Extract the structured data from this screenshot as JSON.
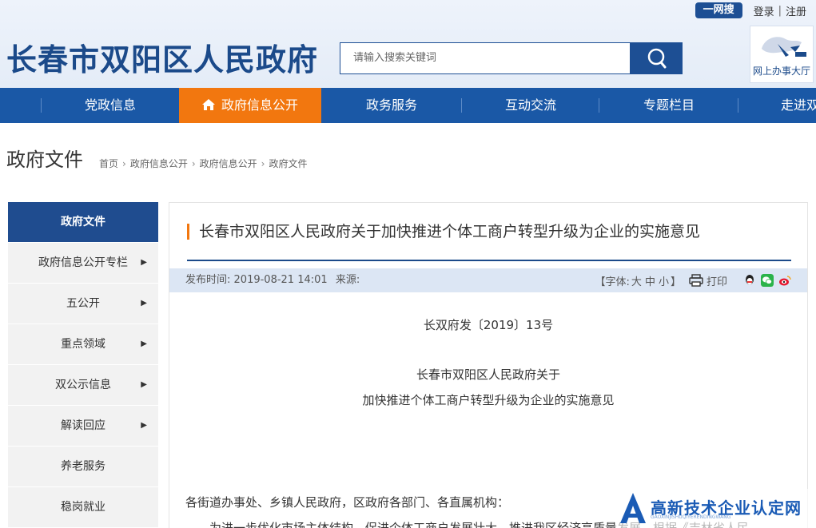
{
  "header": {
    "site_title": "长春市双阳区人民政府",
    "search_scope": "一网搜",
    "login": "登录",
    "register": "注册",
    "separator": "|",
    "search_placeholder": "请输入搜索关键词",
    "portal_label": "网上办事大厅"
  },
  "nav": {
    "items": [
      {
        "label": "党政信息"
      },
      {
        "label": "政府信息公开",
        "active": true
      },
      {
        "label": "政务服务"
      },
      {
        "label": "互动交流"
      },
      {
        "label": "专题栏目"
      },
      {
        "label": "走进双阳"
      }
    ]
  },
  "page": {
    "heading": "政府文件",
    "breadcrumb": [
      "首页",
      "政府信息公开",
      "政府信息公开",
      "政府文件"
    ],
    "breadcrumb_sep": "›"
  },
  "sidebar": {
    "items": [
      {
        "label": "政府文件",
        "active": true
      },
      {
        "label": "政府信息公开专栏",
        "arrow": "▶"
      },
      {
        "label": "五公开",
        "arrow": "▶"
      },
      {
        "label": "重点领域",
        "arrow": "▶"
      },
      {
        "label": "双公示信息",
        "arrow": "▶"
      },
      {
        "label": "解读回应",
        "arrow": "▶"
      },
      {
        "label": "养老服务"
      },
      {
        "label": "稳岗就业"
      }
    ]
  },
  "article": {
    "title": "长春市双阳区人民政府关于加快推进个体工商户转型升级为企业的实施意见",
    "publish_label": "发布时间:",
    "publish_time": "2019-08-21 14:01",
    "source_label": "来源:",
    "font_open": "【字体:",
    "font_large": "大",
    "font_medium": "中",
    "font_small": "小",
    "font_close": "】",
    "print": "打印",
    "doc_number": "长双府发〔2019〕13号",
    "heading_line1": "长春市双阳区人民政府关于",
    "heading_line2": "加快推进个体工商户转型升级为企业的实施意见",
    "salutation": "各街道办事处、乡镇人民政府，区政府各部门、各直属机构：",
    "para1": "为进一步优化市场主体结构，促进个体工商户发展壮大，推进我区经济高质量发展，根据《吉林省人民"
  },
  "watermark": {
    "text": "高新技术企业认定网",
    "small": "GAOXINJISHUQIYERENDINGWANG"
  },
  "colors": {
    "brand_blue": "#1a58a6",
    "title_blue": "#1b4a8a",
    "accent_orange": "#f2770f",
    "sidebar_active": "#1f4c8f",
    "meta_bg": "#dce6f4"
  }
}
